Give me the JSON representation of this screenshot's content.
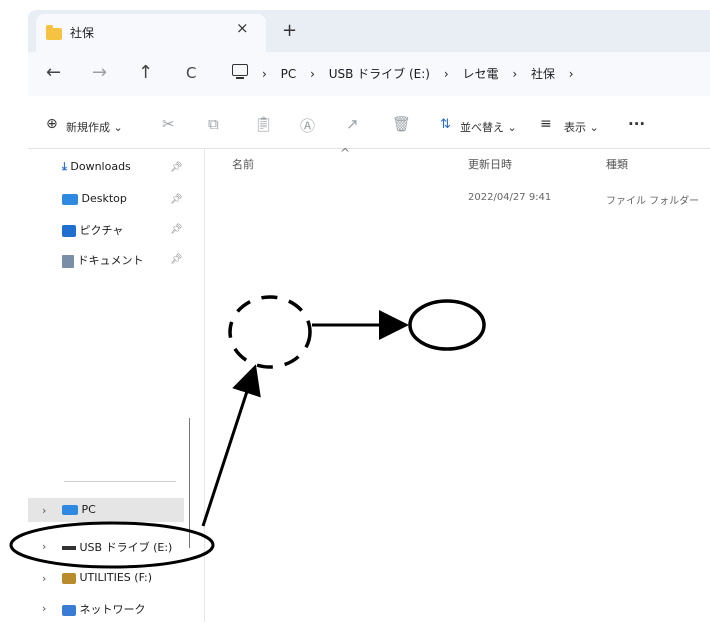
{
  "tab": {
    "title": "社保",
    "close": "×",
    "new": "+"
  },
  "nav": {
    "back": "←",
    "forward": "→",
    "up": "↑",
    "refresh": "C"
  },
  "breadcrumb": {
    "sep": "›",
    "items": [
      "PC",
      "USB ドライブ (E:)",
      "レセ電",
      "社保"
    ]
  },
  "toolbar": {
    "new_label": "新規作成",
    "sort_label": "並べ替え",
    "view_label": "表示",
    "more": "···",
    "caret": "⌄"
  },
  "sidebar": {
    "quick": [
      {
        "label": "Downloads",
        "icon": "download-icon"
      },
      {
        "label": "Desktop",
        "icon": "desktop-icon"
      },
      {
        "label": "ピクチャ",
        "icon": "pictures-icon"
      },
      {
        "label": "ドキュメント",
        "icon": "documents-icon"
      }
    ],
    "drives": [
      {
        "label": "PC",
        "icon": "pc-icon"
      },
      {
        "label": "USB ドライブ (E:)",
        "icon": "usb-drive-icon"
      },
      {
        "label": "UTILITIES (F:)",
        "icon": "drive-icon"
      },
      {
        "label": "ネットワーク",
        "icon": "network-icon"
      }
    ]
  },
  "columns": {
    "name": "名前",
    "modified": "更新日時",
    "type": "種類"
  },
  "rows": [
    {
      "name": "",
      "modified": "2022/04/27 9:41",
      "type": "ファイル フォルダー"
    }
  ]
}
